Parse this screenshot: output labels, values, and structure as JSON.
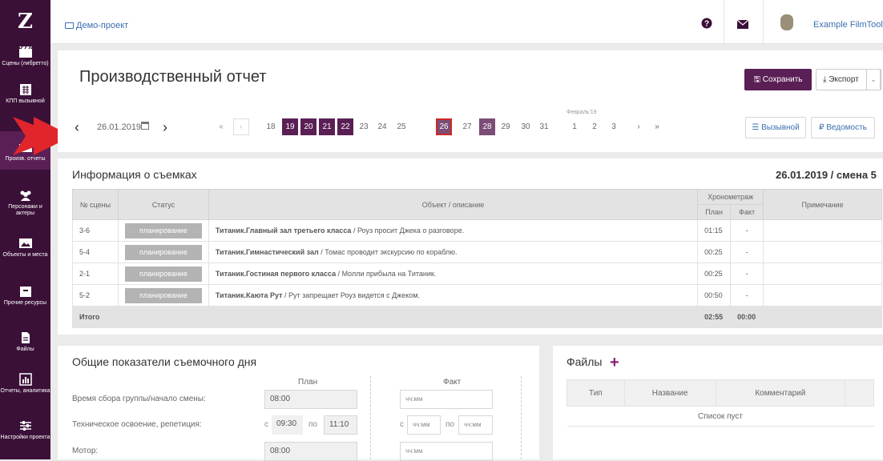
{
  "sidebar": {
    "logo": "Z",
    "items": [
      {
        "label": "Сцены (либретто)"
      },
      {
        "label": "КПП вызывной"
      },
      {
        "label": "Произв. отчеты"
      },
      {
        "label": "Персонажи и актеры"
      },
      {
        "label": "Объекты и места"
      },
      {
        "label": "Прочие ресурсы"
      },
      {
        "label": "Файлы"
      },
      {
        "label": "Отчеты, аналитика"
      },
      {
        "label": "Настройки проекта"
      }
    ]
  },
  "topbar": {
    "breadcrumb": "Демо-проект",
    "username": "Example FilmToolz"
  },
  "header": {
    "title": "Производственный отчет",
    "save_label": "Сохранить",
    "export_label": "Экспорт"
  },
  "date_nav": {
    "current_date": "26.01.2019",
    "days": [
      "18",
      "19",
      "20",
      "21",
      "22",
      "23",
      "24",
      "25",
      "26",
      "27",
      "28",
      "29",
      "30",
      "31",
      "1",
      "2",
      "3"
    ],
    "month_label": "Февраль'19",
    "first_label": "«",
    "prev_label": "‹",
    "next_label": "›",
    "last_label": "»",
    "call_sheet_label": "Вызывной",
    "statement_label": "Ведомость"
  },
  "shooting_info": {
    "title": "Информация о съемках",
    "date_shift": "26.01.2019 / смена 5",
    "columns": {
      "scene": "№ сцены",
      "status": "Статус",
      "object": "Объект / описание",
      "timing": "Хронометраж",
      "plan": "План",
      "fact": "Факт",
      "note": "Примечание"
    },
    "rows": [
      {
        "scene": "3-6",
        "status": "планирование",
        "object": "Титаник.Главный зал третьего класса",
        "desc": " / Роуз просит Джека о разговоре.",
        "plan": "01:15",
        "fact": "-",
        "note": ""
      },
      {
        "scene": "5-4",
        "status": "планирование",
        "object": "Титаник.Гимнастический зал",
        "desc": " / Томас проводит экскурсию по кораблю.",
        "plan": "00:25",
        "fact": "-",
        "note": ""
      },
      {
        "scene": "2-1",
        "status": "планирование",
        "object": "Титаник.Гостиная первого класса",
        "desc": " / Молли прибыла на Титаник.",
        "plan": "00:25",
        "fact": "-",
        "note": ""
      },
      {
        "scene": "5-2",
        "status": "планирование",
        "object": "Титаник.Каюта Рут",
        "desc": " / Рут запрещает Роуз видется с Джеком.",
        "plan": "00:50",
        "fact": "-",
        "note": ""
      }
    ],
    "total": {
      "label": "Итого",
      "plan": "02:55",
      "fact": "00:00"
    }
  },
  "day_metrics": {
    "title": "Общие показатели съемочного дня",
    "plan_header": "План",
    "fact_header": "Факт",
    "from_label": "с",
    "to_label": "по",
    "placeholder": "чч:мм",
    "rows": [
      {
        "label": "Время сбора группы/начало смены:",
        "plan": "08:00"
      },
      {
        "label": "Техническое освоение, репетиция:",
        "plan_from": "09:30",
        "plan_to": "11:10"
      },
      {
        "label": "Мотор:",
        "plan": "08:00"
      }
    ]
  },
  "files": {
    "title": "Файлы",
    "add_label": "+",
    "columns": {
      "type": "Тип",
      "name": "Название",
      "comment": "Комментарий"
    },
    "empty": "Список пуст"
  },
  "colors": {
    "sidebar": "#3b1038",
    "accent": "#5a1f55",
    "link": "#3a6fb0",
    "status_chip": "#b3b3b3",
    "selected_border": "#d12626"
  }
}
